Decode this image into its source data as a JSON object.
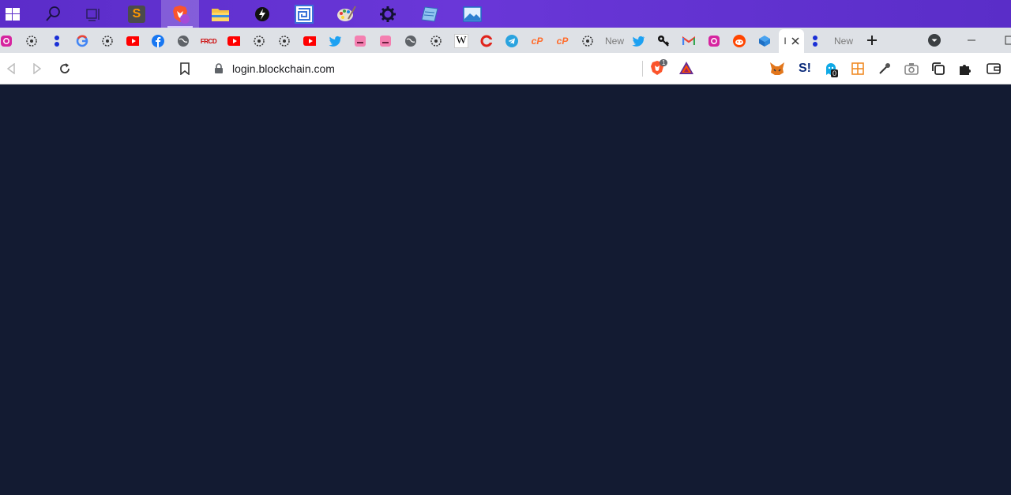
{
  "taskbar": {
    "apps": [
      {
        "name": "windows-start",
        "label": ""
      },
      {
        "name": "search",
        "label": ""
      },
      {
        "name": "task-view",
        "label": ""
      },
      {
        "name": "sublime-text",
        "label": "S"
      },
      {
        "name": "brave-browser",
        "label": ""
      },
      {
        "name": "file-explorer",
        "label": ""
      },
      {
        "name": "black-app",
        "label": ""
      },
      {
        "name": "maze-app",
        "label": ""
      },
      {
        "name": "paint",
        "label": ""
      },
      {
        "name": "settings",
        "label": ""
      },
      {
        "name": "notepad",
        "label": ""
      },
      {
        "name": "photos",
        "label": ""
      }
    ]
  },
  "tabs": {
    "new_tab_1": "New",
    "new_tab_2": "New",
    "active_tab": "I",
    "icons": [
      "instagram-icon",
      "cog-web-icon",
      "dots-icon",
      "google-icon",
      "cog-web-icon",
      "youtube-icon",
      "facebook-icon",
      "globe-icon",
      "frcd-icon",
      "youtube-icon",
      "cog-web-icon",
      "cog-web-icon",
      "youtube-icon",
      "twitter-icon",
      "pink-face-icon",
      "pink-face-icon",
      "globe-icon",
      "cog-web-icon",
      "wikipedia-icon",
      "opera-icon",
      "telegram-icon",
      "cpanel-icon",
      "cpanel-icon",
      "cog-web-icon",
      "new-tab",
      "twitter-icon",
      "key-icon",
      "gmail-icon",
      "instagram-icon",
      "reddit-icon",
      "cube-icon",
      "active-tab",
      "dots-icon",
      "new-tab"
    ],
    "wikipedia_letter": "W",
    "frcd_text": "FRCD",
    "cpanel_text": "cP"
  },
  "toolbar": {
    "url": "login.blockchain.com",
    "brave_shield_count": "1",
    "extension_badge": "0",
    "s_ext_label": "S!"
  },
  "colors": {
    "taskbar": "#5b2cc9",
    "tabstrip": "#dee1e6",
    "page_background": "#131b32"
  }
}
